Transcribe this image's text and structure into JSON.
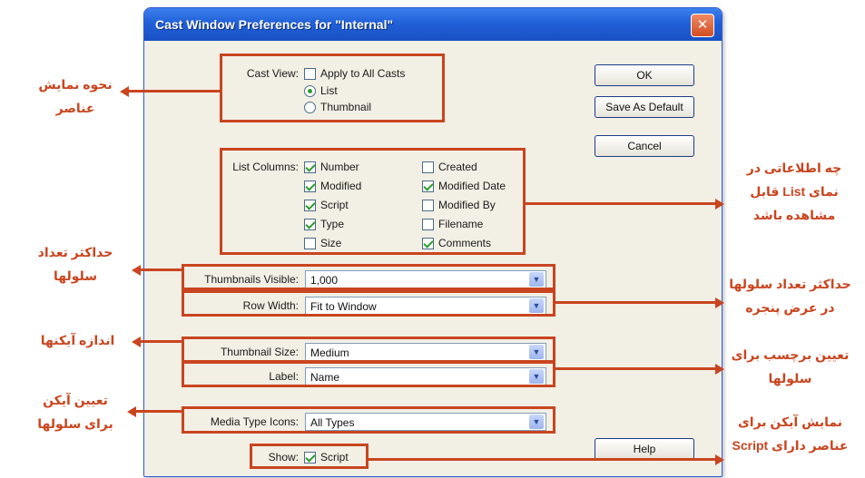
{
  "dialog": {
    "title": "Cast Window Preferences for \"Internal\"",
    "close_glyph": "✕"
  },
  "cast_view": {
    "label": "Cast View:",
    "apply_all": {
      "label": "Apply to All Casts",
      "checked": false
    },
    "list": {
      "label": "List",
      "selected": true
    },
    "thumbnail": {
      "label": "Thumbnail",
      "selected": false
    }
  },
  "list_columns": {
    "label": "List Columns:",
    "items": [
      {
        "label": "Number",
        "checked": true
      },
      {
        "label": "Modified",
        "checked": true
      },
      {
        "label": "Script",
        "checked": true
      },
      {
        "label": "Type",
        "checked": true
      },
      {
        "label": "Size",
        "checked": false
      },
      {
        "label": "Created",
        "checked": false
      },
      {
        "label": "Modified Date",
        "checked": true
      },
      {
        "label": "Modified By",
        "checked": false
      },
      {
        "label": "Filename",
        "checked": false
      },
      {
        "label": "Comments",
        "checked": true
      }
    ]
  },
  "fields": {
    "thumbnails_visible": {
      "label": "Thumbnails Visible:",
      "value": "1,000"
    },
    "row_width": {
      "label": "Row Width:",
      "value": "Fit to Window"
    },
    "thumbnail_size": {
      "label": "Thumbnail Size:",
      "value": "Medium"
    },
    "label": {
      "label": "Label:",
      "value": "Name"
    },
    "media_type_icons": {
      "label": "Media Type Icons:",
      "value": "All Types"
    }
  },
  "show": {
    "label": "Show:",
    "script": {
      "label": "Script",
      "checked": true
    }
  },
  "buttons": {
    "ok": "OK",
    "save_default": "Save As Default",
    "cancel": "Cancel",
    "help": "Help"
  },
  "dropdown_glyph": "▼",
  "annotations": {
    "cast_view": [
      "نحوه نمایش",
      "عناصر"
    ],
    "list_columns": [
      "چه اطلاعاتی در",
      "نمای List قابل",
      "مشاهده باشد"
    ],
    "thumbnails_visible": [
      "حداکثر تعداد",
      "سلولها"
    ],
    "row_width": [
      "حداکثر تعداد سلولها",
      "در عرض پنجره"
    ],
    "thumbnail_size": [
      "اندازه آیکنها"
    ],
    "label": [
      "تعیین برچسب برای",
      "سلولها"
    ],
    "media_type_icons": [
      "تعیین آیکن",
      "برای سلولها"
    ],
    "show_script": [
      "نمایش آیکن برای",
      "عناصر دارای Script"
    ]
  },
  "colors": {
    "annotation": "#c9451f",
    "title_bar": "#2060d8"
  }
}
